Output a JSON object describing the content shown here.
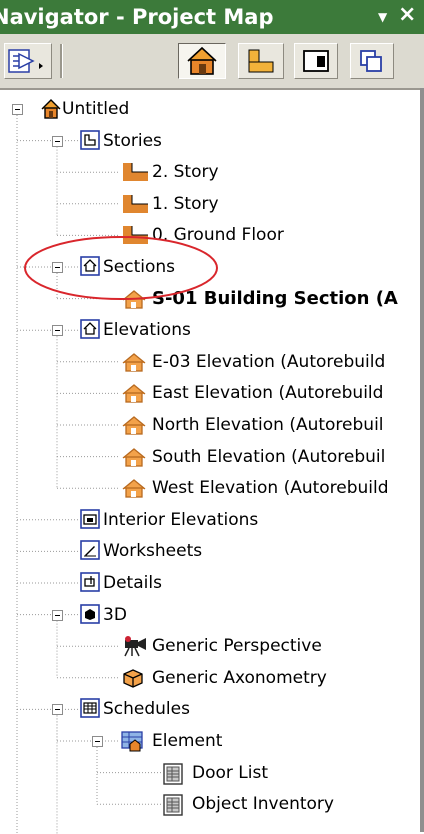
{
  "window": {
    "title": "Navigator - Project Map",
    "menu_glyph": "▼",
    "close_glyph": "×"
  },
  "toolbar": {
    "buttons": [
      {
        "name": "navigator-popup-button",
        "icon": "popup-arrow-icon"
      },
      {
        "name": "project-map-button",
        "icon": "project-map-house-icon",
        "pressed": true
      },
      {
        "name": "view-map-button",
        "icon": "view-map-icon"
      },
      {
        "name": "layout-book-button",
        "icon": "layout-book-icon"
      },
      {
        "name": "publisher-sets-button",
        "icon": "publisher-sets-icon"
      }
    ]
  },
  "annotation": {
    "color": "#d9262c",
    "shape": "ellipse-around-sections"
  },
  "tree": [
    {
      "label": "Untitled",
      "icon": "house-icon",
      "level": 0,
      "expanded": true
    },
    {
      "label": "Stories",
      "icon": "stories-icon",
      "level": 1,
      "expanded": true
    },
    {
      "label": "2. Story",
      "icon": "story-icon",
      "level": 2
    },
    {
      "label": "1. Story",
      "icon": "story-icon",
      "level": 2
    },
    {
      "label": "0. Ground Floor",
      "icon": "story-icon",
      "level": 2
    },
    {
      "label": "Sections",
      "icon": "sections-icon",
      "level": 1,
      "expanded": true
    },
    {
      "label": "S-01 Building Section (A",
      "icon": "section-view-icon",
      "level": 2,
      "selected": true
    },
    {
      "label": "Elevations",
      "icon": "elevations-icon",
      "level": 1,
      "expanded": true
    },
    {
      "label": "E-03 Elevation (Autorebuild",
      "icon": "elevation-view-icon",
      "level": 2
    },
    {
      "label": "East Elevation (Autorebuild",
      "icon": "elevation-view-icon",
      "level": 2
    },
    {
      "label": "North Elevation (Autorebuil",
      "icon": "elevation-view-icon",
      "level": 2
    },
    {
      "label": "South Elevation (Autorebuil",
      "icon": "elevation-view-icon",
      "level": 2
    },
    {
      "label": "West Elevation (Autorebuild",
      "icon": "elevation-view-icon",
      "level": 2
    },
    {
      "label": "Interior Elevations",
      "icon": "interior-elevations-icon",
      "level": 1
    },
    {
      "label": "Worksheets",
      "icon": "worksheets-icon",
      "level": 1
    },
    {
      "label": "Details",
      "icon": "details-icon",
      "level": 1
    },
    {
      "label": "3D",
      "icon": "3d-icon",
      "level": 1,
      "expanded": true
    },
    {
      "label": "Generic Perspective",
      "icon": "camera-icon",
      "level": 2
    },
    {
      "label": "Generic Axonometry",
      "icon": "axonometry-icon",
      "level": 2
    },
    {
      "label": "Schedules",
      "icon": "schedules-icon",
      "level": 1,
      "expanded": true
    },
    {
      "label": "Element",
      "icon": "element-schedule-icon",
      "level": 2,
      "expanded": true
    },
    {
      "label": "Door List",
      "icon": "list-icon",
      "level": 3
    },
    {
      "label": "Object Inventory",
      "icon": "list-icon",
      "level": 3
    }
  ],
  "colors": {
    "titlebar": "#3c7a3a",
    "toolbar": "#dcdad0",
    "folder_blue": "#2a3fa6",
    "story_orange": "#e0862f",
    "annotation_red": "#d9262c"
  }
}
